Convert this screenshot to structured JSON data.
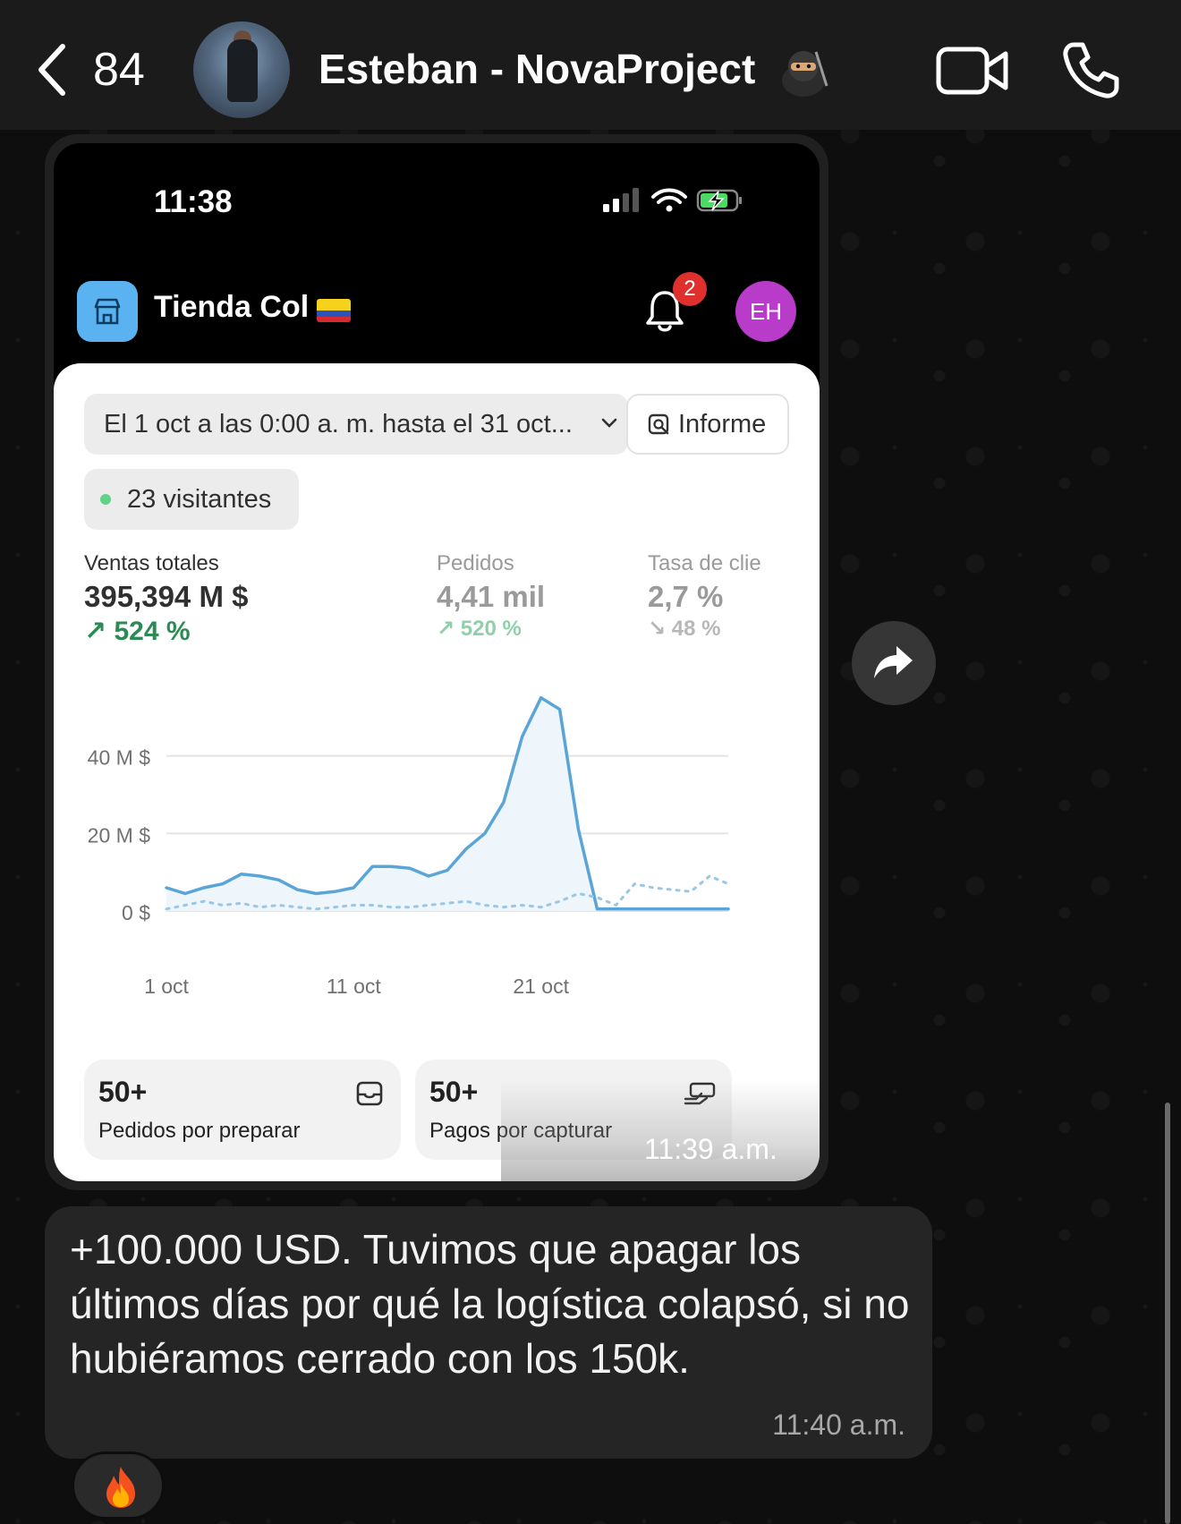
{
  "header": {
    "back_count": "84",
    "contact_name": "Esteban - NovaProject",
    "contact_emoji": "ninja"
  },
  "screenshot": {
    "status_time": "11:38",
    "store_name": "Tienda Col",
    "notification_count": "2",
    "user_initials": "EH",
    "date_range": "El 1 oct a las 0:00 a. m. hasta el 31 oct...",
    "report_label": "Informe",
    "visitors": "23 visitantes",
    "metrics": [
      {
        "label": "Ventas totales",
        "value": "395,394 M $",
        "change": "↗ 524 %"
      },
      {
        "label": "Pedidos",
        "value": "4,41 mil",
        "change": "↗ 520 %"
      },
      {
        "label": "Tasa de clie",
        "value": "2,7 %",
        "change": "↘ 48 %"
      }
    ],
    "tiles": [
      {
        "number": "50+",
        "label": "Pedidos por preparar"
      },
      {
        "number": "50+",
        "label": "Pagos por capturar"
      }
    ],
    "image_time": "11:39 a.m."
  },
  "message": {
    "text": "+100.000 USD. Tuvimos que apagar los últimos días por qué la logística colapsó, si no hubiéramos cerrado con los 150k.",
    "time": "11:40 a.m.",
    "reaction": "fire"
  },
  "chart_data": {
    "type": "line",
    "x_ticks": [
      "1 oct",
      "11 oct",
      "21 oct"
    ],
    "y_ticks": [
      "0 $",
      "20 M $",
      "40 M $"
    ],
    "ylim": [
      0,
      60
    ],
    "xlim": [
      1,
      31
    ],
    "grid": true,
    "series": [
      {
        "color": "#5aa5d8",
        "style": "solid",
        "x": [
          1,
          2,
          3,
          4,
          5,
          6,
          7,
          8,
          9,
          10,
          11,
          12,
          13,
          14,
          15,
          16,
          17,
          18,
          19,
          20,
          21,
          22,
          23,
          24,
          25,
          26,
          27,
          28,
          29,
          30,
          31
        ],
        "y": [
          6,
          4.5,
          6,
          7,
          9.5,
          9,
          8,
          5.5,
          4.5,
          5,
          6,
          11.5,
          11.5,
          11,
          9,
          10.5,
          16,
          20,
          28,
          45,
          55,
          52,
          21,
          0.5,
          0.5,
          0.5,
          0.5,
          0.5,
          0.5,
          0.5,
          0.5
        ]
      },
      {
        "color": "#9ac7e6",
        "style": "dotted",
        "x": [
          1,
          2,
          3,
          4,
          5,
          6,
          7,
          8,
          9,
          10,
          11,
          12,
          13,
          14,
          15,
          16,
          17,
          18,
          19,
          20,
          21,
          22,
          23,
          24,
          25,
          26,
          27,
          28,
          29,
          30,
          31
        ],
        "y": [
          0.5,
          1.5,
          2.5,
          1.5,
          2,
          1,
          1.5,
          1,
          0.5,
          1,
          1.5,
          1.5,
          1,
          1,
          1.5,
          2,
          2.5,
          1.5,
          1,
          1.5,
          1,
          2.5,
          4.5,
          3.5,
          1.5,
          7,
          6,
          5.5,
          5,
          9,
          7
        ]
      }
    ]
  }
}
